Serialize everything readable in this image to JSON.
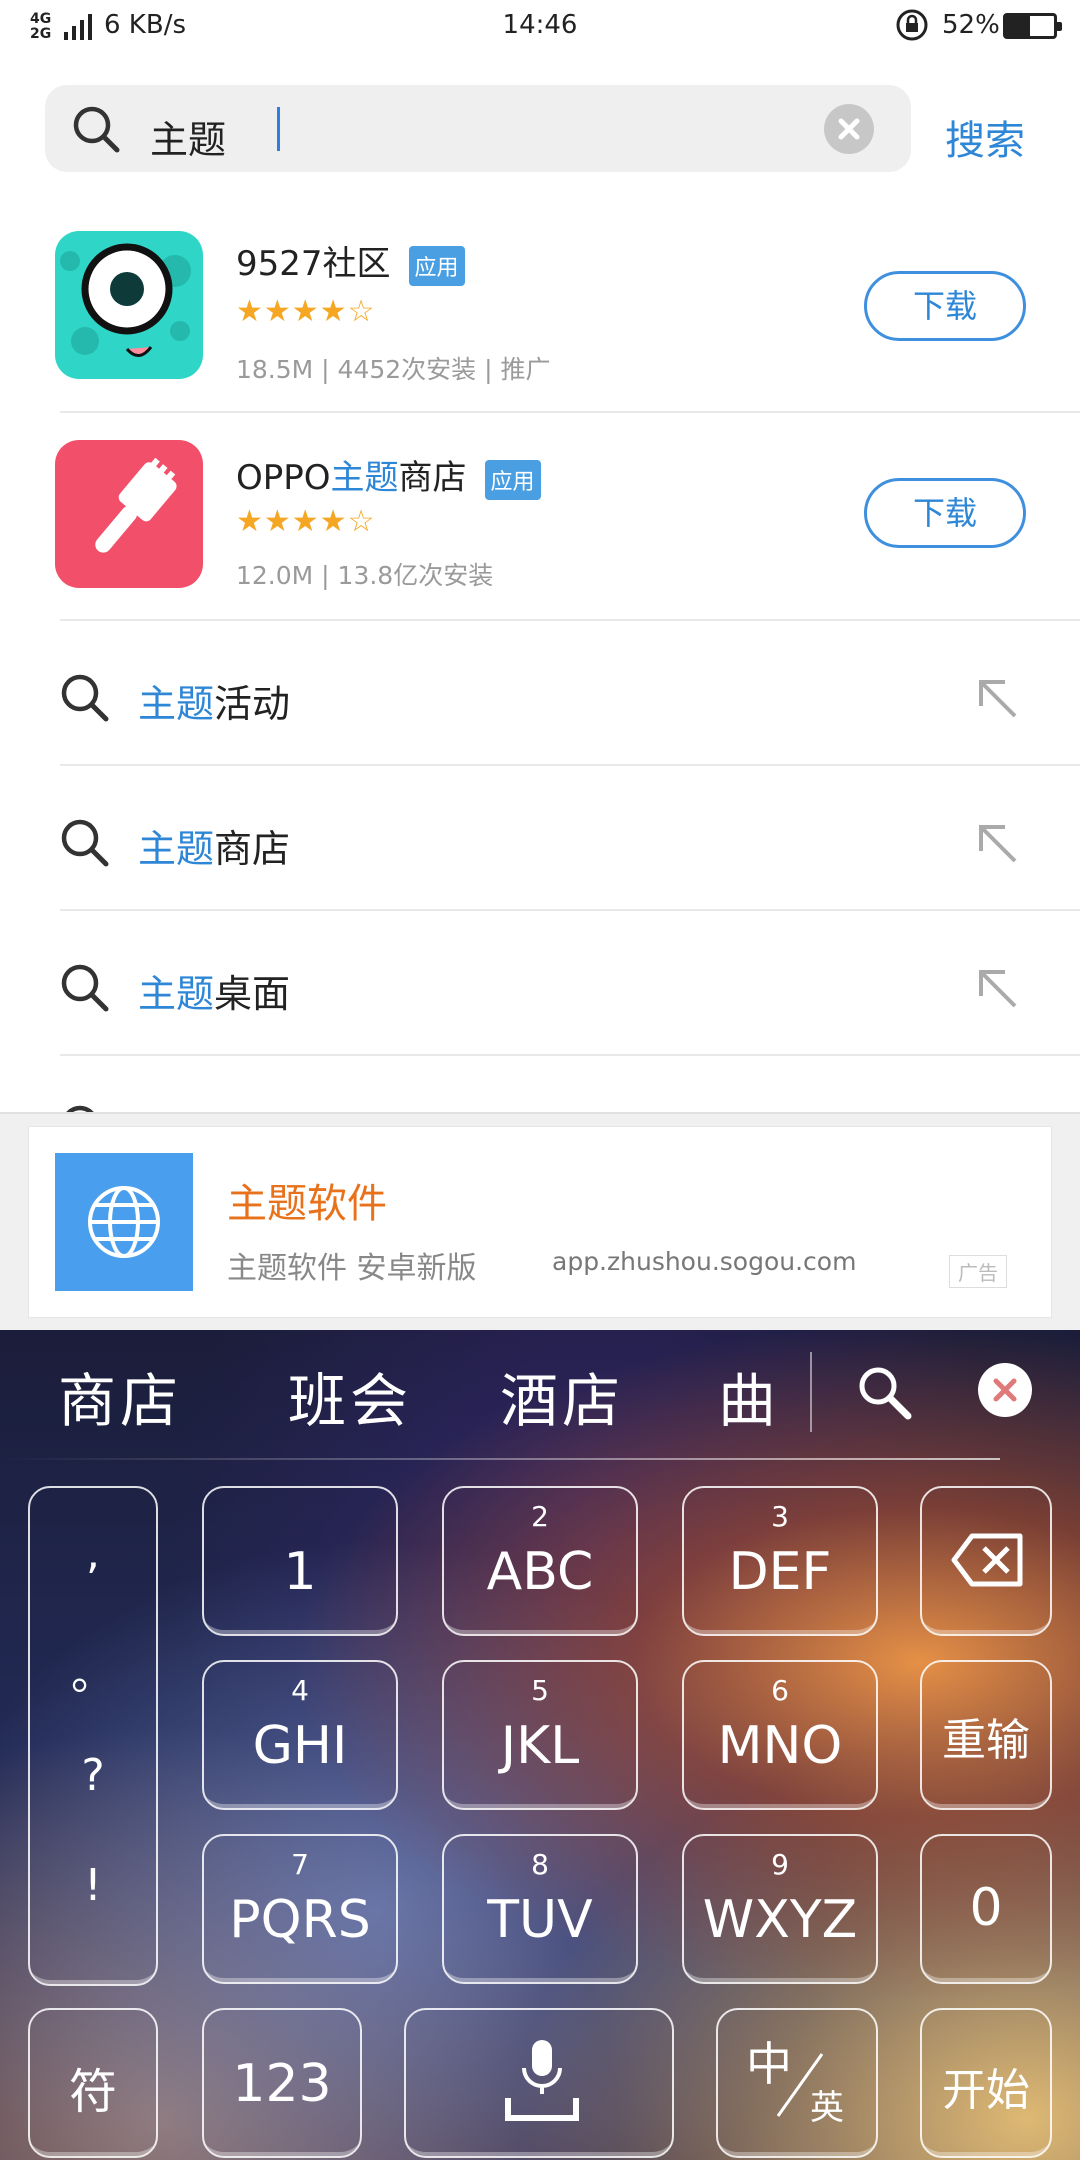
{
  "status_bar": {
    "network": "4G\n2G",
    "speed": "6 KB/s",
    "time": "14:46",
    "battery_level": "52%"
  },
  "search": {
    "query": "主题",
    "search_button": "搜索"
  },
  "apps": [
    {
      "name": "9527社区",
      "badge": "应用",
      "rating": 4,
      "rating_display": "★★★★☆",
      "meta": "18.5M | 4452次安装 | 推广",
      "download_label": "下载",
      "icon_color": "#2fd6c8"
    },
    {
      "name_prefix": "OPPO",
      "name_highlight": "主题",
      "name_suffix": "商店",
      "badge": "应用",
      "rating": 4,
      "rating_display": "★★★★☆",
      "meta": "12.0M | 13.8亿次安装",
      "download_label": "下载",
      "icon_color": "#f2506a"
    }
  ],
  "suggestions": [
    {
      "highlight": "主题",
      "rest": "活动"
    },
    {
      "highlight": "主题",
      "rest": "商店"
    },
    {
      "highlight": "主题",
      "rest": "桌面"
    }
  ],
  "ad": {
    "title": "主题软件",
    "description": "主题软件 安卓新版",
    "url": "app.zhushou.sogou.com",
    "tag": "广告"
  },
  "keyboard": {
    "candidates": [
      "商店",
      "班会",
      "酒店",
      "曲"
    ],
    "punctuation": [
      ",",
      "。",
      "?",
      "!"
    ],
    "keys": [
      {
        "num": "",
        "label": "1"
      },
      {
        "num": "2",
        "label": "ABC"
      },
      {
        "num": "3",
        "label": "DEF"
      },
      {
        "num": "4",
        "label": "GHI"
      },
      {
        "num": "5",
        "label": "JKL"
      },
      {
        "num": "6",
        "label": "MNO"
      },
      {
        "num": "7",
        "label": "PQRS"
      },
      {
        "num": "8",
        "label": "TUV"
      },
      {
        "num": "9",
        "label": "WXYZ"
      }
    ],
    "reinput": "重输",
    "zero": "0",
    "symbol": "符",
    "numeric": "123",
    "lang_main": "中",
    "lang_alt": "英",
    "start": "开始"
  }
}
